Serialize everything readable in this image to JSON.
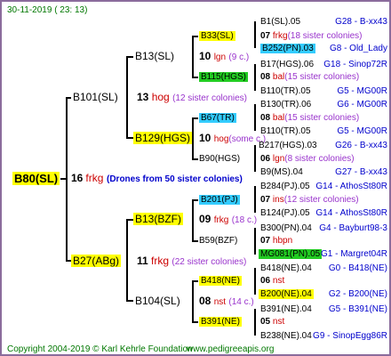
{
  "header": {
    "date": "30-11-2019 ( 23: 13)"
  },
  "footer": {
    "copyright": "Copyright 2004-2019 © Karl Kehrle Foundation",
    "site": "www.pedigreeapis.org"
  },
  "root": {
    "id": "B80(SL)",
    "gen": "16",
    "line": "frkg",
    "note": "(Drones from 50 sister colonies)"
  },
  "b101": {
    "id": "B101(SL)",
    "gen": "13",
    "line": "hog",
    "note": "(12 sister colonies)"
  },
  "b27": {
    "id": "B27(ABg)",
    "gen": "11",
    "line": "frkg",
    "note": "(22 sister colonies)"
  },
  "b13sl": {
    "id": "B13(SL)",
    "gen": "10",
    "line": "lgn",
    "note": "(9 c.)"
  },
  "b129": {
    "id": "B129(HGS)",
    "gen": "10",
    "line": "hog",
    "note": "(some c.)"
  },
  "b13bzf": {
    "id": "B13(BZF)",
    "gen": "09",
    "line": "frkg",
    "note": "(18 c.)"
  },
  "b104": {
    "id": "B104(SL)",
    "gen": "08",
    "line": "nst",
    "note": "(14 c.)"
  },
  "g4": {
    "b33": {
      "id": "B33(SL)",
      "gen": "07",
      "line": "frkg",
      "note": "(18 sister colonies)"
    },
    "b115": {
      "id": "B115(HGS)",
      "gen": "08",
      "line": "bal",
      "note": "(15 sister colonies)"
    },
    "b67": {
      "id": "B67(TR)",
      "gen": "08",
      "line": "bal",
      "note": "(15 sister colonies)"
    },
    "b90": {
      "id": "B90(HGS)",
      "gen": "06",
      "line": "lgn",
      "note": "(8 sister colonies)"
    },
    "b201": {
      "id": "B201(PJ)",
      "gen": "07",
      "line": "ins",
      "note": "(12 sister colonies)"
    },
    "b59": {
      "id": "B59(BZF)",
      "gen": "07",
      "line": "hbpn",
      "note": ""
    },
    "b418": {
      "id": "B418(NE)",
      "gen": "06",
      "line": "nst",
      "note": ""
    },
    "b391": {
      "id": "B391(NE)",
      "gen": "05",
      "line": "nst",
      "note": ""
    }
  },
  "g5": [
    {
      "id": "B1(SL).05",
      "code": "G28 - B-xx43"
    },
    {
      "id": "B252(PN).03",
      "code": "G8 - Old_Lady"
    },
    {
      "id": "B17(HGS).06",
      "code": "G18 - Sinop72R"
    },
    {
      "id": "B110(TR).05",
      "code": "G5 - MG00R"
    },
    {
      "id": "B130(TR).06",
      "code": "G6 - MG00R"
    },
    {
      "id": "B110(TR).05",
      "code": "G5 - MG00R"
    },
    {
      "id": "B217(HGS).03",
      "code": "G26 - B-xx43"
    },
    {
      "id": "B9(MS).04",
      "code": "G27 - B-xx43"
    },
    {
      "id": "B284(PJ).05",
      "code": "G14 - AthosSt80R"
    },
    {
      "id": "B124(PJ).05",
      "code": "G14 - AthosSt80R"
    },
    {
      "id": "B300(PN).04",
      "code": "G4 - Bayburt98-3"
    },
    {
      "id": "MG081(PN).05",
      "code": "G1 - Margret04R"
    },
    {
      "id": "B418(NE).04",
      "code": "G0 - B418(NE)"
    },
    {
      "id": "B200(NE).04",
      "code": "G2 - B200(NE)"
    },
    {
      "id": "B391(NE).04",
      "code": "G5 - B391(NE)"
    },
    {
      "id": "B238(NE).04",
      "code": "G9 - SinopEgg86R"
    }
  ]
}
